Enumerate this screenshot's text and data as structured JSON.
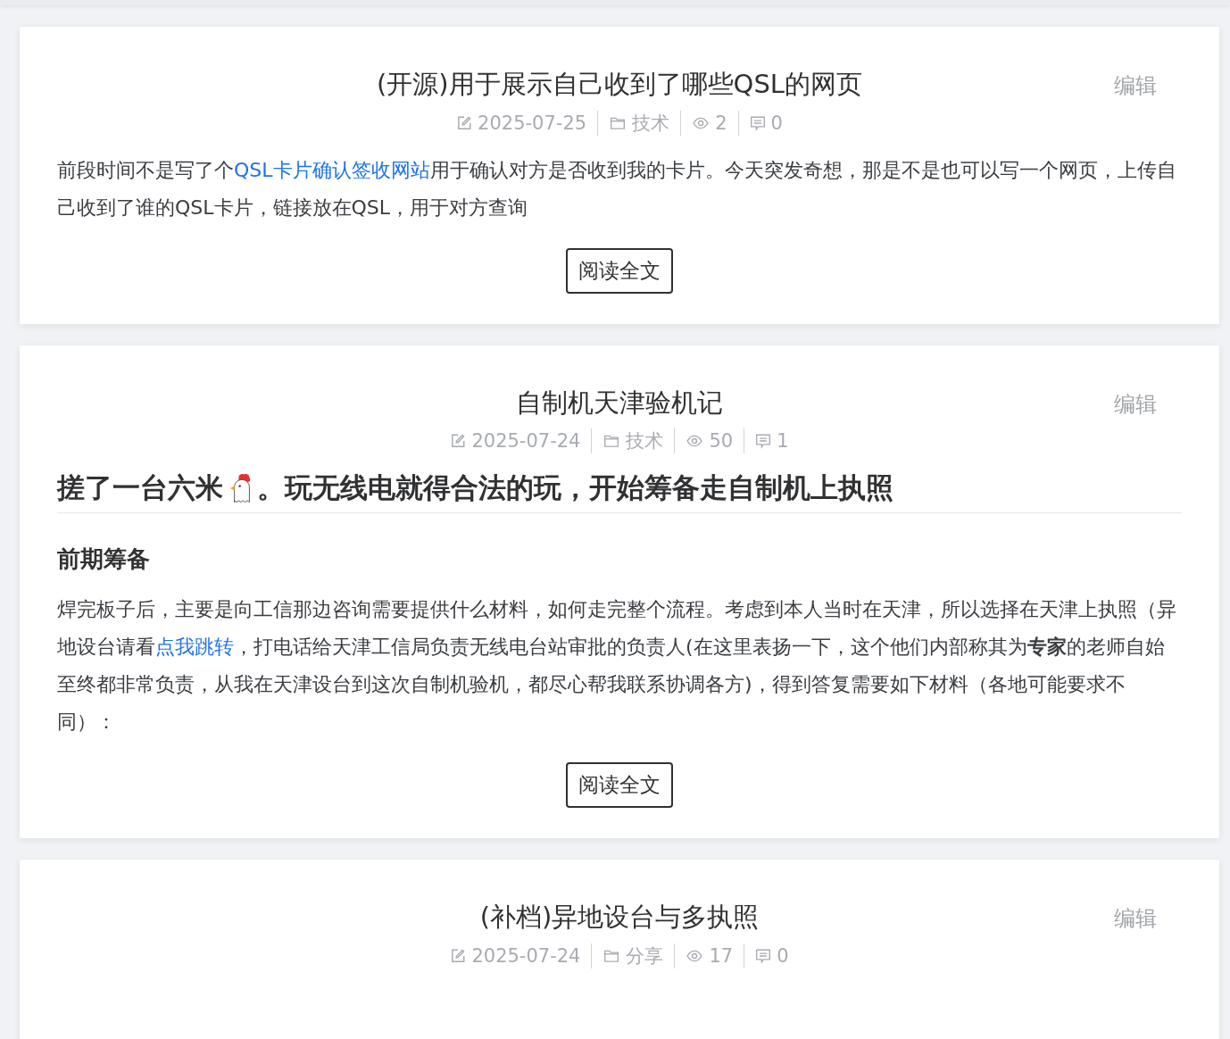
{
  "posts": [
    {
      "title": "(开源)用于展示自己收到了哪些QSL的网页",
      "edit": "编辑",
      "meta": {
        "date": "2025-07-25",
        "category": "技术",
        "views": "2",
        "comments": "0"
      },
      "content": [
        {
          "kind": "paragraph",
          "segments": [
            {
              "kind": "text",
              "text": "前段时间不是写了个"
            },
            {
              "kind": "link",
              "text": "QSL卡片确认签收网站"
            },
            {
              "kind": "text",
              "text": "用于确认对方是否收到我的卡片。今天突发奇想，那是不是也可以写一个网页，上传自己收到了谁的QSL卡片，链接放在QSL，用于对方查询"
            }
          ]
        }
      ],
      "read_more": "阅读全文"
    },
    {
      "title": "自制机天津验机记",
      "edit": "编辑",
      "meta": {
        "date": "2025-07-24",
        "category": "技术",
        "views": "50",
        "comments": "1"
      },
      "content": [
        {
          "kind": "heading",
          "segments": [
            {
              "kind": "text",
              "text": "搓了一台六米"
            },
            {
              "kind": "chicken"
            },
            {
              "kind": "text",
              "text": "。玩无线电就得合法的玩，开始筹备走自制机上执照"
            }
          ]
        },
        {
          "kind": "subheading",
          "text": "前期筹备"
        },
        {
          "kind": "paragraph",
          "segments": [
            {
              "kind": "text",
              "text": "焊完板子后，主要是向工信那边咨询需要提供什么材料，如何走完整个流程。考虑到本人当时在天津，所以选择在天津上执照（异地设台请看"
            },
            {
              "kind": "link",
              "text": "点我跳转"
            },
            {
              "kind": "text",
              "text": "，打电话给天津工信局负责无线电台站审批的负责人(在这里表扬一下，这个他们内部称其为**专家**的老师自始至终都非常负责，从我在天津设台到这次自制机验机，都尽心帮我联系协调各方)，得到答复需要如下材料（各地可能要求不同）："
            }
          ]
        }
      ],
      "read_more": "阅读全文"
    },
    {
      "title": "(补档)异地设台与多执照",
      "edit": "编辑",
      "meta": {
        "date": "2025-07-24",
        "category": "分享",
        "views": "17",
        "comments": "0"
      }
    }
  ]
}
